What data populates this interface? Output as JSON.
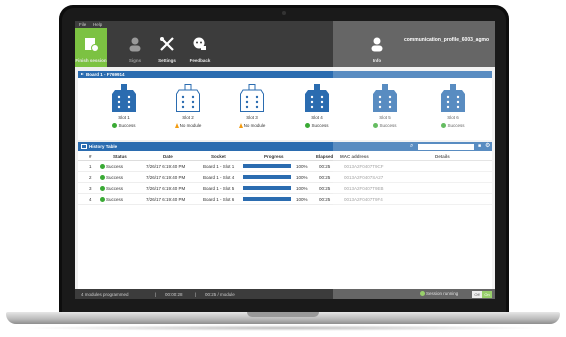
{
  "menu": {
    "file": "File",
    "help": "Help"
  },
  "toolbar": {
    "finish": "Finish session",
    "signs": "Signs",
    "settings": "Settings",
    "feedback": "Feedback"
  },
  "profile": {
    "name": "communication_profile_6003_agmo",
    "label": "Info"
  },
  "board": {
    "title": "Board 1 - F769914",
    "slots": [
      {
        "name": "Slot 1",
        "status": "Success",
        "kind": "ok"
      },
      {
        "name": "Slot 2",
        "status": "No module",
        "kind": "warn"
      },
      {
        "name": "Slot 3",
        "status": "No module",
        "kind": "warn"
      },
      {
        "name": "Slot 4",
        "status": "Success",
        "kind": "ok"
      },
      {
        "name": "Slot 5",
        "status": "Success",
        "kind": "ok"
      },
      {
        "name": "Slot 6",
        "status": "Success",
        "kind": "ok"
      }
    ]
  },
  "history": {
    "title": "History Table",
    "columns": [
      "#",
      "Status",
      "Date",
      "Socket",
      "Progress",
      "Elapsed",
      "MAC address",
      "Details"
    ],
    "rows": [
      {
        "num": "1",
        "status": "Success",
        "date": "7/26/17 6:19:40 PM",
        "socket": "Board 1 - Slot 1",
        "progress": 1.0,
        "progress_text": "100%",
        "elapsed": "00:25",
        "mac": "0013A2F0407T9CF"
      },
      {
        "num": "2",
        "status": "Success",
        "date": "7/26/17 6:19:40 PM",
        "socket": "Board 1 - Slot 4",
        "progress": 1.0,
        "progress_text": "100%",
        "elapsed": "00:25",
        "mac": "0013A2F0407SA27"
      },
      {
        "num": "3",
        "status": "Success",
        "date": "7/26/17 6:19:40 PM",
        "socket": "Board 1 - Slot 5",
        "progress": 1.0,
        "progress_text": "100%",
        "elapsed": "00:25",
        "mac": "0013A2F0407T9EB"
      },
      {
        "num": "4",
        "status": "Success",
        "date": "7/26/17 6:19:40 PM",
        "socket": "Board 1 - Slot 6",
        "progress": 1.0,
        "progress_text": "100%",
        "elapsed": "00:25",
        "mac": "0013A2F0407T9F4"
      }
    ]
  },
  "statusbar": {
    "modules": "4 modules programmed",
    "time": "00:00:28",
    "rate": "00:25 / module",
    "session": "Session running",
    "off": "Off",
    "on": "On"
  },
  "colors": {
    "accent": "#7cc242",
    "primary": "#2b6cb0",
    "warning": "#f39c12"
  }
}
